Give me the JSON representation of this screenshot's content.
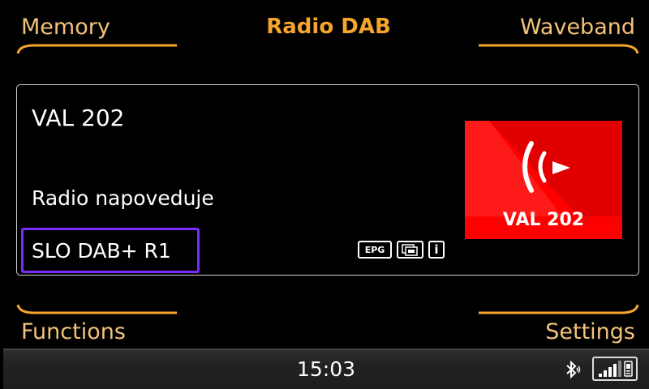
{
  "header": {
    "left_label": "Memory",
    "title": "Radio DAB",
    "right_label": "Waveband"
  },
  "footer": {
    "left_label": "Functions",
    "right_label": "Settings"
  },
  "station_panel": {
    "station_name": "VAL 202",
    "radio_text": "Radio napoveduje",
    "ensemble": "SLO DAB+ R1",
    "icons": {
      "epg": "EPG",
      "slideshow": "slideshow-icon",
      "info": "i"
    },
    "logo_text": "VAL 202"
  },
  "status_bar": {
    "time": "15:03",
    "bluetooth_icon": "bluetooth-icon",
    "signal_icon": "signal-strength-icon"
  },
  "colors": {
    "accent_orange": "#f5a52b",
    "label_orange": "#f3c27a",
    "selection_purple": "#7a2bff",
    "logo_red": "#ff0000"
  }
}
